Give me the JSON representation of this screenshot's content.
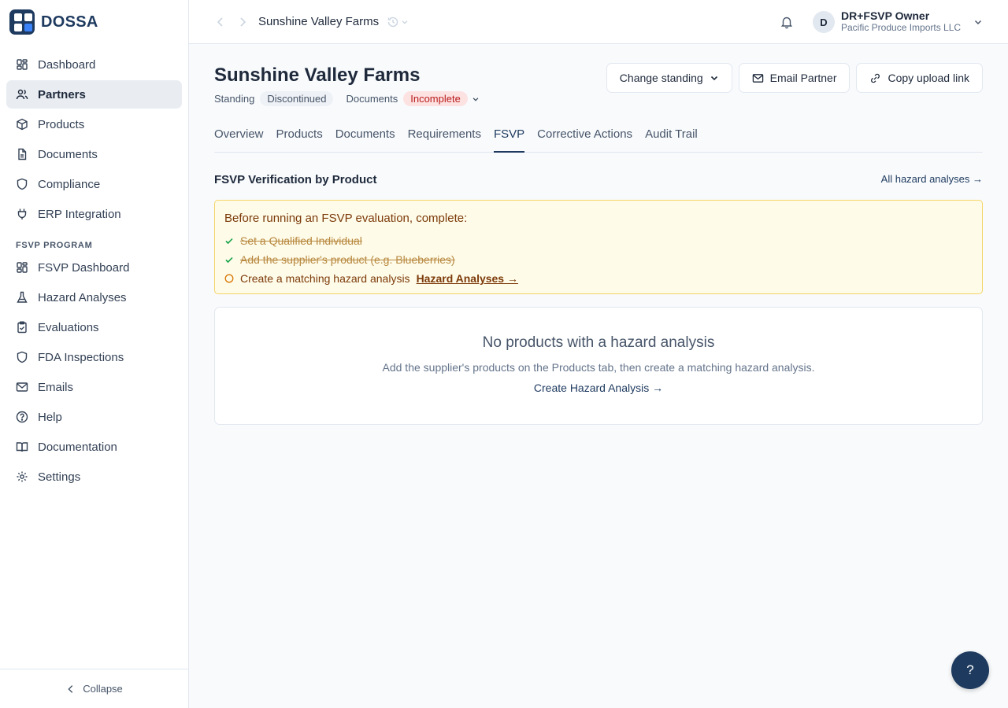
{
  "app": {
    "name": "DOSSA"
  },
  "sidebar": {
    "items": [
      {
        "label": "Dashboard",
        "icon": "dashboard-icon"
      },
      {
        "label": "Partners",
        "icon": "users-icon",
        "active": true
      },
      {
        "label": "Products",
        "icon": "package-icon"
      },
      {
        "label": "Documents",
        "icon": "document-icon"
      },
      {
        "label": "Compliance",
        "icon": "shield-icon"
      },
      {
        "label": "ERP Integration",
        "icon": "plug-icon"
      }
    ],
    "section_label": "FSVP PROGRAM",
    "fsvp_items": [
      {
        "label": "FSVP Dashboard",
        "icon": "dashboard-icon"
      },
      {
        "label": "Hazard Analyses",
        "icon": "flask-icon"
      },
      {
        "label": "Evaluations",
        "icon": "clipboard-icon"
      },
      {
        "label": "FDA Inspections",
        "icon": "shield-icon"
      },
      {
        "label": "Emails",
        "icon": "mail-icon"
      },
      {
        "label": "Help",
        "icon": "help-circle-icon"
      },
      {
        "label": "Documentation",
        "icon": "book-icon"
      },
      {
        "label": "Settings",
        "icon": "gear-icon"
      }
    ],
    "collapse_label": "Collapse"
  },
  "topbar": {
    "breadcrumb": "Sunshine Valley Farms",
    "user_initial": "D",
    "user_name": "DR+FSVP Owner",
    "user_org": "Pacific Produce Imports LLC"
  },
  "page": {
    "title": "Sunshine Valley Farms",
    "standing_label": "Standing",
    "standing_value": "Discontinued",
    "documents_label": "Documents",
    "documents_value": "Incomplete",
    "actions": {
      "change_standing": "Change standing",
      "email_partner": "Email Partner",
      "copy_upload_link": "Copy upload link"
    },
    "tabs": [
      "Overview",
      "Products",
      "Documents",
      "Requirements",
      "FSVP",
      "Corrective Actions",
      "Audit Trail"
    ],
    "active_tab": "FSVP"
  },
  "fsvp": {
    "section_title": "FSVP Verification by Product",
    "section_link": "All hazard analyses →",
    "notice": {
      "title": "Before running an FSVP evaluation, complete:",
      "steps": [
        {
          "text": "Set a Qualified Individual",
          "done": true
        },
        {
          "text": "Add the supplier's product (e.g. Blueberries)",
          "done": true
        },
        {
          "text": "Create a matching hazard analysis",
          "done": false,
          "link": "Hazard Analyses →"
        }
      ]
    },
    "empty": {
      "title": "No products with a hazard analysis",
      "description": "Add the supplier's products on the Products tab, then create a matching hazard analysis.",
      "link": "Create Hazard Analysis →"
    }
  },
  "help_fab": "?",
  "colors": {
    "brand": "#1e3a5f",
    "warning_bg": "#fefbe8",
    "danger": "#b91c1c",
    "success": "#16a34a"
  }
}
